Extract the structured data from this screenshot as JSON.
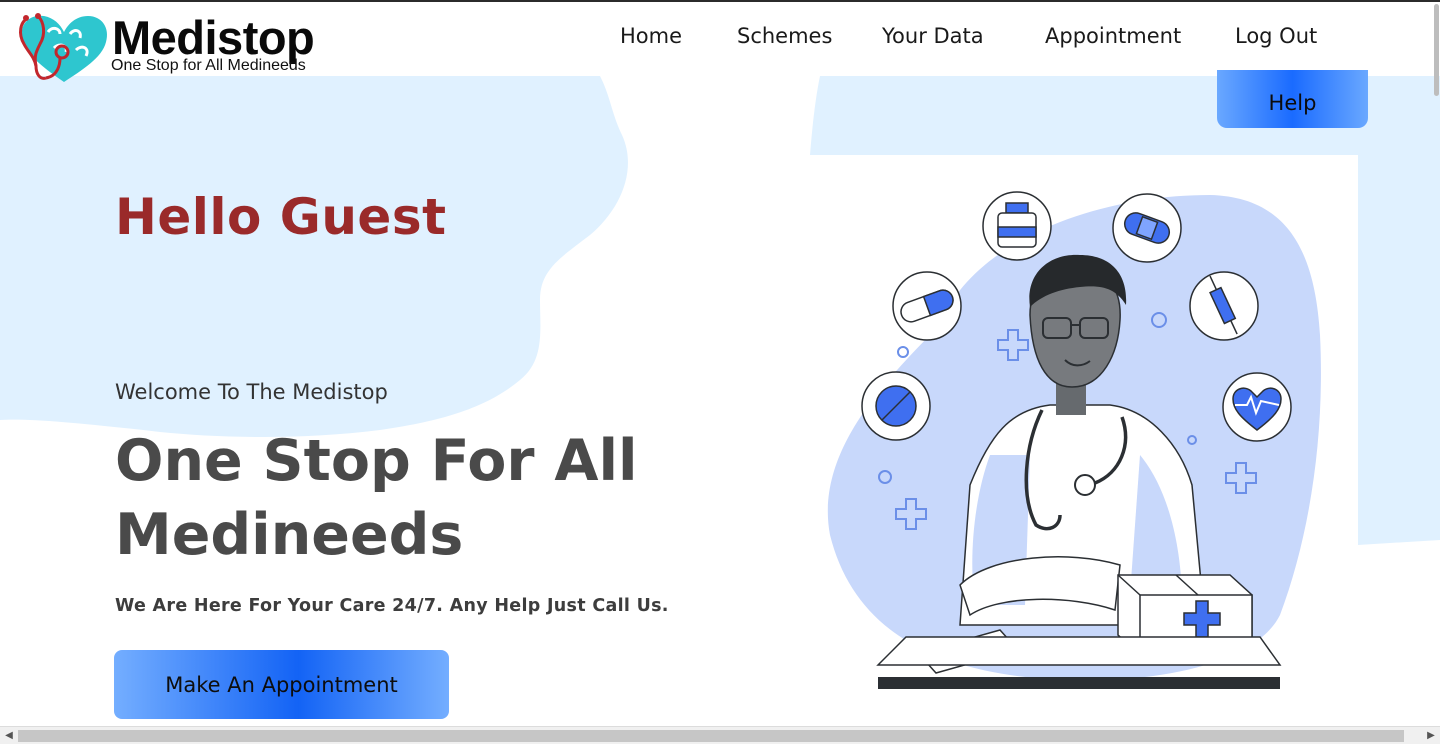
{
  "brand": {
    "name": "Medistop",
    "tagline": "One Stop for All Medineeds",
    "colors": {
      "accent_blue": "#1a6bff",
      "greeting_red": "#9a2a2a",
      "blob_light_blue": "#e0f1ff"
    }
  },
  "nav": {
    "items": [
      {
        "label": "Home"
      },
      {
        "label": "Schemes"
      },
      {
        "label": "Your Data"
      },
      {
        "label": "Appointment"
      },
      {
        "label": "Log Out"
      }
    ],
    "help_label": "Help"
  },
  "hero": {
    "greeting": "Hello Guest",
    "welcome": "Welcome To The Medistop",
    "headline": "One Stop For All Medineeds",
    "subline": "We Are Here For Your Care 24/7. Any Help Just Call Us.",
    "cta_label": "Make An Appointment"
  },
  "illustration": {
    "icons": [
      "medicine-bottle-icon",
      "bandage-icon",
      "capsule-icon",
      "syringe-icon",
      "pill-icon",
      "heart-pulse-icon",
      "medical-kit-icon",
      "notebook-icon",
      "stethoscope-icon"
    ]
  },
  "scrollbar": {
    "left_arrow": "◀",
    "right_arrow": "▶"
  }
}
